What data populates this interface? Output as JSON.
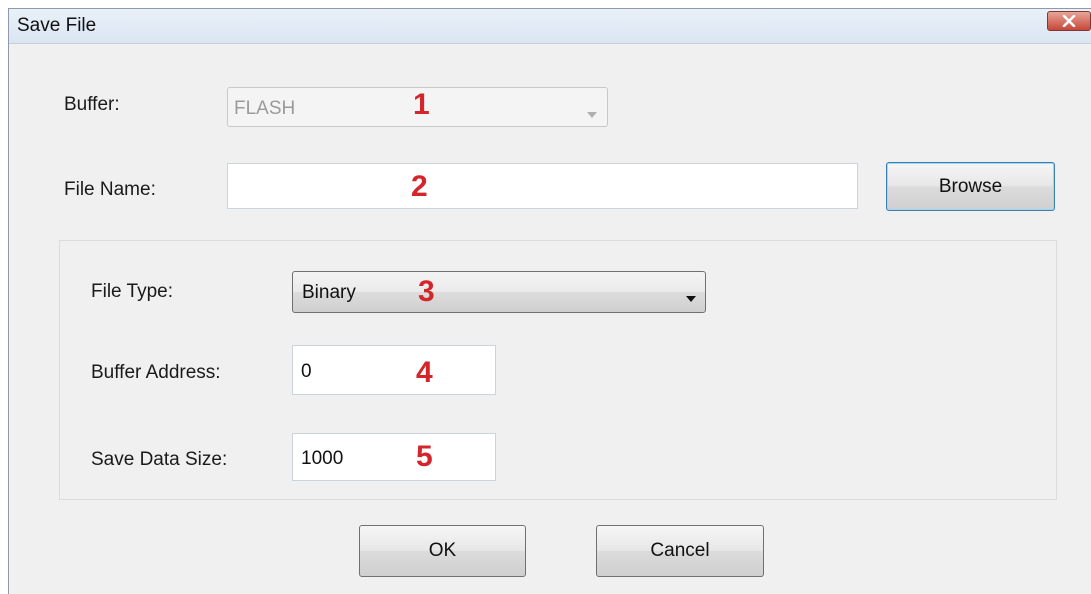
{
  "window": {
    "title": "Save File"
  },
  "buffer": {
    "label": "Buffer:",
    "value": "FLASH",
    "marker": "1"
  },
  "file_name": {
    "label": "File Name:",
    "value": "",
    "marker": "2",
    "browse_label": "Browse"
  },
  "file_type": {
    "label": "File Type:",
    "value": "Binary",
    "marker": "3"
  },
  "buffer_address": {
    "label": "Buffer Address:",
    "value": "0",
    "marker": "4"
  },
  "save_data_size": {
    "label": "Save Data Size:",
    "value": "1000",
    "marker": "5"
  },
  "buttons": {
    "ok_label": "OK",
    "cancel_label": "Cancel"
  },
  "colors": {
    "marker": "#d4262a",
    "close_button": "#c7473a",
    "default_button_border": "#3c7fb1"
  },
  "icons": {
    "close": "close-icon",
    "dropdown": "chevron-down-icon"
  }
}
